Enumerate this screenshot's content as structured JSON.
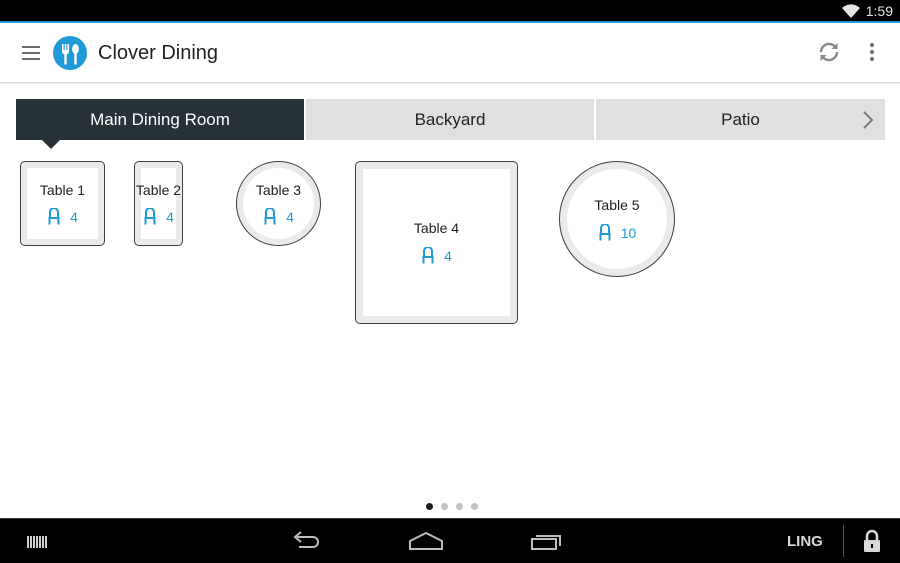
{
  "status_bar": {
    "time": "1:59",
    "icons": [
      "wifi-icon"
    ]
  },
  "app_bar": {
    "title": "Clover Dining",
    "icons": [
      "menu-icon",
      "clover-dining-logo",
      "sync-icon",
      "overflow-menu-icon"
    ]
  },
  "tabs": [
    {
      "label": "Main Dining Room",
      "active": true
    },
    {
      "label": "Backyard",
      "active": false
    },
    {
      "label": "Patio",
      "active": false
    }
  ],
  "tabs_next_icon": "chevron-right-icon",
  "tables": [
    {
      "name": "Table 1",
      "seats": "4",
      "shape": "square"
    },
    {
      "name": "Table 2",
      "seats": "4",
      "shape": "rectangle"
    },
    {
      "name": "Table 3",
      "seats": "4",
      "shape": "round"
    },
    {
      "name": "Table 4",
      "seats": "4",
      "shape": "square"
    },
    {
      "name": "Table 5",
      "seats": "10",
      "shape": "round"
    }
  ],
  "pager": {
    "pages": 4,
    "current": 1
  },
  "nav_bar": {
    "user": "LING",
    "icons": [
      "barcode-icon",
      "back-icon",
      "home-icon",
      "recent-apps-icon",
      "lock-icon"
    ]
  },
  "colors": {
    "accent": "#1e9ad6",
    "active_tab": "#263238",
    "inactive_tab": "#dfe0e2"
  }
}
